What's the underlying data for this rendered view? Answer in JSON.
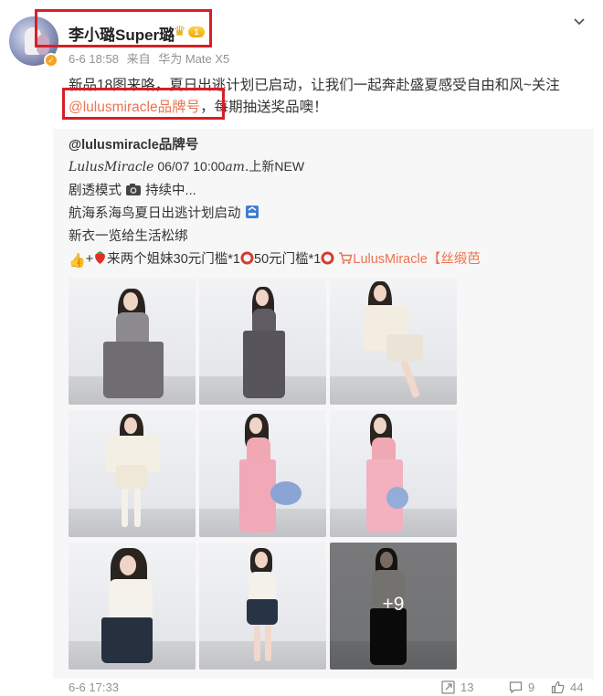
{
  "post": {
    "username": "李小璐Super璐",
    "level_badge": "1",
    "date": "6-6 18:58",
    "source_prefix": "来自",
    "source_device": "华为 Mate X5",
    "text_line1": "新品18图来咯，夏日出逃计划已启动，让我们一起奔赴盛夏感受自由和风~关注",
    "mention": "@lulusmiracle品牌号",
    "text_line2_rest": "，每期抽送奖品噢！"
  },
  "repost": {
    "author": "@lulusmiracle品牌号",
    "line2_brand": "LulusMiracle",
    "line2_time": " 06/07 10:00",
    "line2_ampm": "am.",
    "line2_new": "上新NEW",
    "line3": "剧透模式",
    "line3_rest": "持续中...",
    "line4": "航海系海鸟夏日出逃计划启动",
    "line5": "新衣一览给生活松绑",
    "line6_a": "+",
    "line6_b": "来两个姐妹30元门槛*1",
    "line6_c": "50元门槛*1",
    "shop_link": "LulusMiracle【丝缎芭",
    "more_count": "+9"
  },
  "footer": {
    "date": "6-6 17:33",
    "reposts": "13",
    "comments": "9",
    "likes": "44"
  },
  "colors": {
    "link": "#eb7350",
    "highlight_box": "#d61f26",
    "repost_bg": "#f7f7f7",
    "meta": "#939393"
  }
}
